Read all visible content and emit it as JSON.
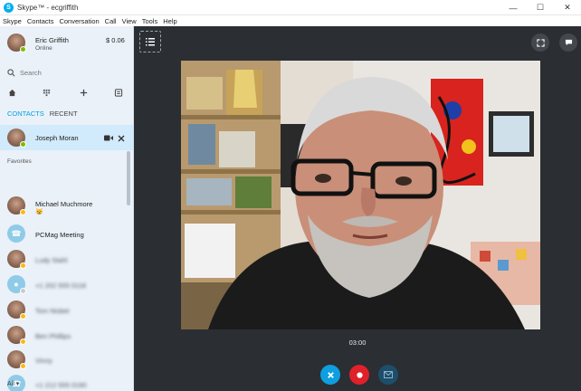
{
  "window": {
    "title": "Skype™ - ecgriffith",
    "logo_letter": "S",
    "controls": {
      "minimize": "—",
      "maximize": "☐",
      "close": "✕"
    }
  },
  "menu": [
    "Skype",
    "Contacts",
    "Conversation",
    "Call",
    "View",
    "Tools",
    "Help"
  ],
  "profile": {
    "name": "Eric Griffith",
    "status": "Online",
    "credit": "$ 0.06"
  },
  "search": {
    "placeholder": "Search"
  },
  "tabs": {
    "contacts": "CONTACTS",
    "recent": "RECENT"
  },
  "selected_contact": {
    "name": "Joseph Moran"
  },
  "favorites_label": "Favorites",
  "contacts": [
    {
      "name": "Michael Muchmore",
      "sub": "😸",
      "status": "away",
      "avatar": "person"
    },
    {
      "name": "PCMag Meeting",
      "sub": "",
      "status": "none",
      "avatar": "phone"
    },
    {
      "name": "Ludy Stahl",
      "sub": "",
      "status": "away",
      "avatar": "person"
    },
    {
      "name": "+1 202 555 0118",
      "sub": "",
      "status": "offline",
      "avatar": "generic"
    },
    {
      "name": "Tom Nisbet",
      "sub": "",
      "status": "away",
      "avatar": "person"
    },
    {
      "name": "Ben Phillips",
      "sub": "",
      "status": "away",
      "avatar": "person"
    },
    {
      "name": "Vinny",
      "sub": "",
      "status": "away",
      "avatar": "person"
    },
    {
      "name": "+1 212 555 0190",
      "sub": "",
      "status": "none",
      "avatar": "phone"
    }
  ],
  "footer": {
    "filter": "All ▾"
  },
  "call": {
    "timer": "03:00",
    "colors": {
      "end_call": "#0e9fe0",
      "record": "#e0202a",
      "message": "#1d4e6b",
      "background": "#2b2e33"
    }
  },
  "icons": {
    "roster": "list-icon",
    "fullscreen": "expand-icon",
    "chat": "chat-bubble-icon"
  }
}
